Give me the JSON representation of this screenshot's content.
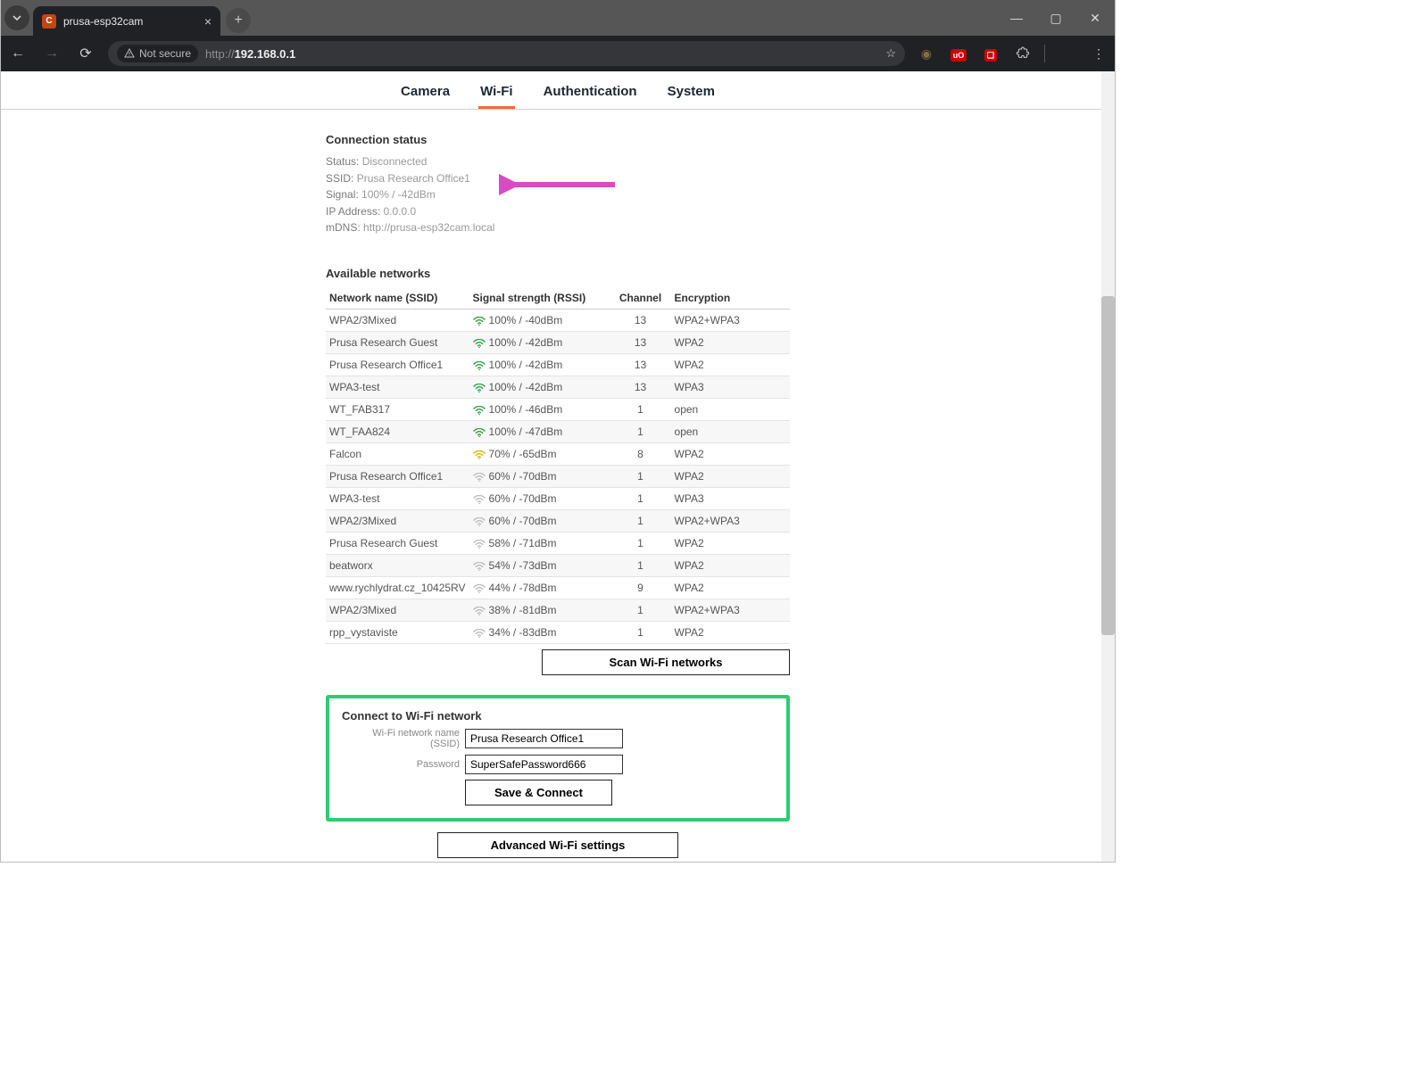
{
  "browser": {
    "tab_title": "prusa-esp32cam",
    "not_secure": "Not secure",
    "url_protocol": "http://",
    "url_host": "192.168.0.1",
    "ext_badge": "uO"
  },
  "tabs": {
    "camera": "Camera",
    "wifi": "Wi-Fi",
    "auth": "Authentication",
    "system": "System"
  },
  "conn": {
    "heading": "Connection status",
    "status_l": "Status:",
    "status_v": "Disconnected",
    "ssid_l": "SSID:",
    "ssid_v": "Prusa Research Office1",
    "sig_l": "Signal:",
    "sig_v": "100% / -42dBm",
    "ip_l": "IP Address:",
    "ip_v": "0.0.0.0",
    "mdns_l": "mDNS:",
    "mdns_v": "http://prusa-esp32cam.local"
  },
  "nets": {
    "heading": "Available networks",
    "h_ssid": "Network name (SSID)",
    "h_rssi": "Signal strength (RSSI)",
    "h_ch": "Channel",
    "h_enc": "Encryption",
    "rows": [
      {
        "ssid": "WPA2/3Mixed",
        "rssi": "100% / -40dBm",
        "ch": "13",
        "enc": "WPA2+WPA3",
        "lvl": "hi"
      },
      {
        "ssid": "Prusa Research Guest",
        "rssi": "100% / -42dBm",
        "ch": "13",
        "enc": "WPA2",
        "lvl": "hi"
      },
      {
        "ssid": "Prusa Research Office1",
        "rssi": "100% / -42dBm",
        "ch": "13",
        "enc": "WPA2",
        "lvl": "hi"
      },
      {
        "ssid": "WPA3-test",
        "rssi": "100% / -42dBm",
        "ch": "13",
        "enc": "WPA3",
        "lvl": "hi"
      },
      {
        "ssid": "WT_FAB317",
        "rssi": "100% / -46dBm",
        "ch": "1",
        "enc": "open",
        "lvl": "hi"
      },
      {
        "ssid": "WT_FAA824",
        "rssi": "100% / -47dBm",
        "ch": "1",
        "enc": "open",
        "lvl": "hi"
      },
      {
        "ssid": "Falcon",
        "rssi": "70% / -65dBm",
        "ch": "8",
        "enc": "WPA2",
        "lvl": "md"
      },
      {
        "ssid": "Prusa Research Office1",
        "rssi": "60% / -70dBm",
        "ch": "1",
        "enc": "WPA2",
        "lvl": "lo"
      },
      {
        "ssid": "WPA3-test",
        "rssi": "60% / -70dBm",
        "ch": "1",
        "enc": "WPA3",
        "lvl": "lo"
      },
      {
        "ssid": "WPA2/3Mixed",
        "rssi": "60% / -70dBm",
        "ch": "1",
        "enc": "WPA2+WPA3",
        "lvl": "lo"
      },
      {
        "ssid": "Prusa Research Guest",
        "rssi": "58% / -71dBm",
        "ch": "1",
        "enc": "WPA2",
        "lvl": "lo"
      },
      {
        "ssid": "beatworx",
        "rssi": "54% / -73dBm",
        "ch": "1",
        "enc": "WPA2",
        "lvl": "lo"
      },
      {
        "ssid": "www.rychlydrat.cz_10425RV",
        "rssi": "44% / -78dBm",
        "ch": "9",
        "enc": "WPA2",
        "lvl": "lo"
      },
      {
        "ssid": "WPA2/3Mixed",
        "rssi": "38% / -81dBm",
        "ch": "1",
        "enc": "WPA2+WPA3",
        "lvl": "lo"
      },
      {
        "ssid": "rpp_vystaviste",
        "rssi": "34% / -83dBm",
        "ch": "1",
        "enc": "WPA2",
        "lvl": "lo"
      }
    ],
    "btn_scan": "Scan Wi-Fi networks"
  },
  "form": {
    "heading": "Connect to Wi-Fi network",
    "ssid_l": "Wi-Fi network name (SSID)",
    "ssid_v": "Prusa Research Office1",
    "pwd_l": "Password",
    "pwd_v": "SuperSafePassword666",
    "btn_save": "Save & Connect",
    "btn_adv": "Advanced Wi-Fi settings"
  }
}
